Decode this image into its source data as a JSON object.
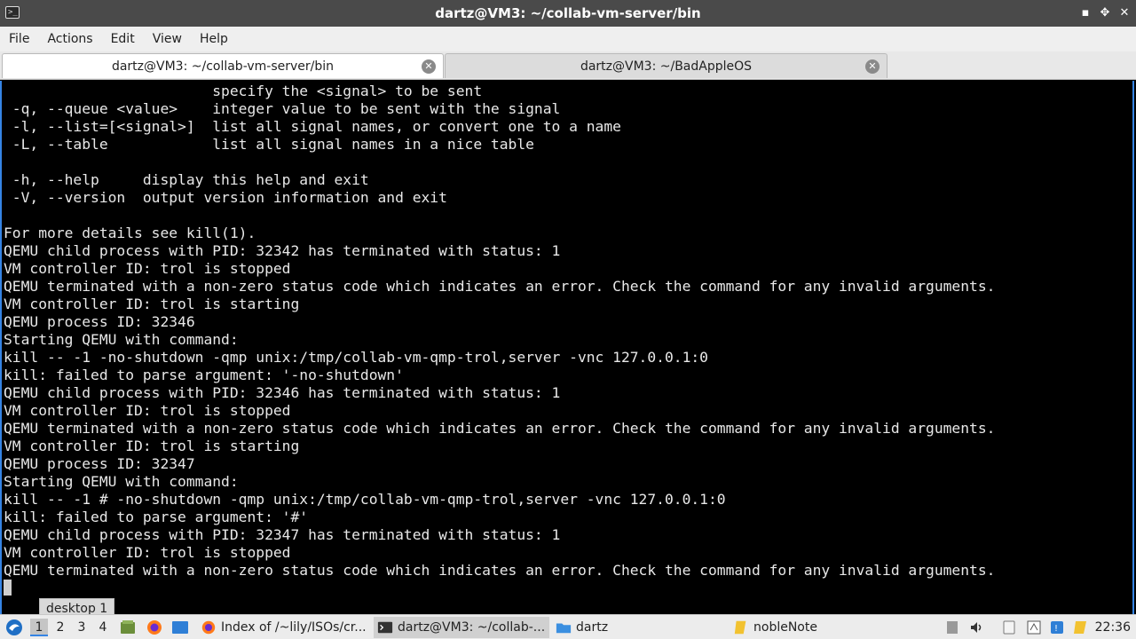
{
  "window": {
    "title": "dartz@VM3: ~/collab-vm-server/bin",
    "app_icon": ">_",
    "controls": {
      "minimize": "▪",
      "maximize": "✥",
      "close": "✕"
    }
  },
  "menubar": {
    "items": [
      "File",
      "Actions",
      "Edit",
      "View",
      "Help"
    ]
  },
  "tabs": [
    {
      "label": "dartz@VM3: ~/collab-vm-server/bin",
      "active": true
    },
    {
      "label": "dartz@VM3: ~/BadAppleOS",
      "active": false
    }
  ],
  "terminal": {
    "lines": [
      "                        specify the <signal> to be sent",
      " -q, --queue <value>    integer value to be sent with the signal",
      " -l, --list=[<signal>]  list all signal names, or convert one to a name",
      " -L, --table            list all signal names in a nice table",
      "",
      " -h, --help     display this help and exit",
      " -V, --version  output version information and exit",
      "",
      "For more details see kill(1).",
      "QEMU child process with PID: 32342 has terminated with status: 1",
      "VM controller ID: trol is stopped",
      "QEMU terminated with a non-zero status code which indicates an error. Check the command for any invalid arguments.",
      "VM controller ID: trol is starting",
      "QEMU process ID: 32346",
      "Starting QEMU with command:",
      "kill -- -1 -no-shutdown -qmp unix:/tmp/collab-vm-qmp-trol,server -vnc 127.0.0.1:0",
      "kill: failed to parse argument: '-no-shutdown'",
      "QEMU child process with PID: 32346 has terminated with status: 1",
      "VM controller ID: trol is stopped",
      "QEMU terminated with a non-zero status code which indicates an error. Check the command for any invalid arguments.",
      "VM controller ID: trol is starting",
      "QEMU process ID: 32347",
      "Starting QEMU with command:",
      "kill -- -1 # -no-shutdown -qmp unix:/tmp/collab-vm-qmp-trol,server -vnc 127.0.0.1:0",
      "kill: failed to parse argument: '#'",
      "QEMU child process with PID: 32347 has terminated with status: 1",
      "VM controller ID: trol is stopped",
      "QEMU terminated with a non-zero status code which indicates an error. Check the command for any invalid arguments."
    ]
  },
  "tooltip": "desktop 1",
  "taskbar": {
    "desktops": [
      "1",
      "2",
      "3",
      "4"
    ],
    "active_desktop": "1",
    "tasks": [
      {
        "label": "Index of /~lily/ISOs/cr...",
        "icon": "firefox-icon"
      },
      {
        "label": "dartz@VM3: ~/collab-...",
        "icon": "terminal-icon",
        "active": true
      },
      {
        "label": "dartz",
        "icon": "folder-icon"
      },
      {
        "label": "nobleNote",
        "icon": "notepad-icon"
      }
    ],
    "clock": "22:36"
  },
  "colors": {
    "accent": "#3584e4",
    "titlebar": "#4a4a4a",
    "terminal_bg": "#000000"
  }
}
